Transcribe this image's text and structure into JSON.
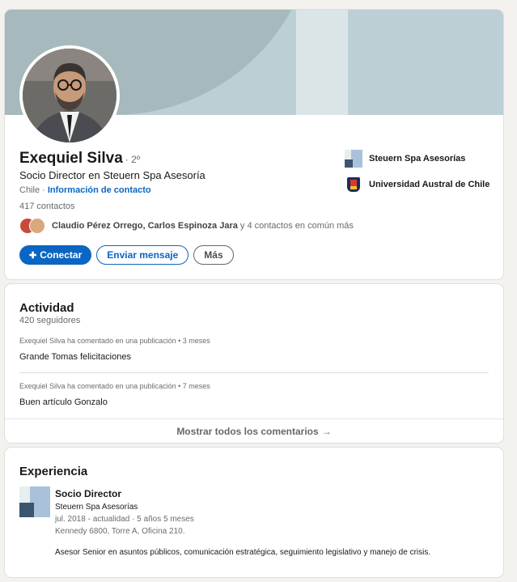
{
  "profile": {
    "name": "Exequiel Silva",
    "degree": "· 2º",
    "headline": "Socio Director en Steuern Spa Asesoría",
    "location": "Chile ·",
    "contact_info": "Información de contacto",
    "connections": "417 contactos",
    "mutual": {
      "names": "Claudio Pérez Orrego, Carlos Espinoza Jara",
      "rest": " y 4 contactos en común más"
    },
    "actions": {
      "connect": "Conectar",
      "message": "Enviar mensaje",
      "more": "Más"
    },
    "orgs": [
      {
        "name": "Steuern Spa Asesorías"
      },
      {
        "name": "Universidad Austral de Chile"
      }
    ]
  },
  "activity": {
    "title": "Actividad",
    "followers": "420 seguidores",
    "posts": [
      {
        "meta": "Exequiel Silva ha comentado en una publicación • 3 meses",
        "text": "Grande Tomas felicitaciones"
      },
      {
        "meta": "Exequiel Silva ha comentado en una publicación • 7 meses",
        "text": "Buen artículo Gonzalo"
      }
    ],
    "show_all": "Mostrar todos los comentarios",
    "show_all_arrow": "→"
  },
  "experience": {
    "title": "Experiencia",
    "items": [
      {
        "role": "Socio Director",
        "company": "Steuern Spa Asesorías",
        "dates": "jul. 2018 - actualidad · 5 años 5 meses",
        "location": "Kennedy 6800, Torre A, Oficina 210.",
        "description": "Asesor Senior en asuntos públicos, comunicación estratégica, seguimiento legislativo y manejo de crisis."
      }
    ]
  },
  "colors": {
    "accent": "#0a66c2",
    "cover": "#bccfd5",
    "background": "#f3f2ef"
  }
}
